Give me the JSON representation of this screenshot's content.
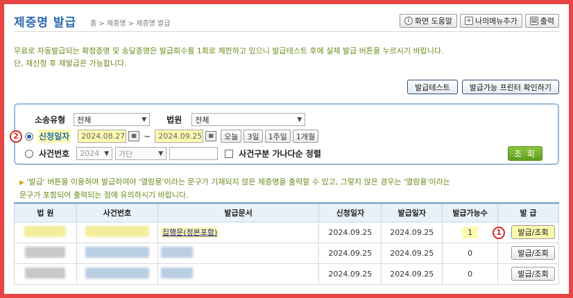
{
  "header": {
    "title": "제증명 발급",
    "breadcrumb": "홈 > 제증명 > 제증명 발급",
    "help_label": "화면 도움말",
    "mymenu_label": "나의메뉴추가",
    "print_label": "출력"
  },
  "notice": {
    "line1": "무료로 자동발급되는 확정증명 및 송달증명은 발급회수를 1회로 제한하고 있으니 발급테스트 후에 실제 발급 버튼을 누르시기 바랍니다.",
    "line2": "단, 재신청 후 재발급은 가능합니다."
  },
  "actions": {
    "test_label": "발급테스트",
    "printer_check_label": "발급가능 프린터 확인하기"
  },
  "search": {
    "type_label": "소송유형",
    "type_value": "전체",
    "court_label": "법원",
    "court_value": "전체",
    "date_label": "신청일자",
    "date_from": "2024.08.27",
    "date_to": "2024.09.25",
    "tilde": "~",
    "quick": [
      "오늘",
      "3일",
      "1주일",
      "1개월"
    ],
    "case_label": "사건번호",
    "case_year": "2024",
    "case_kind": "가단",
    "sort_label": "사건구분 가나다순 정렬",
    "search_label": "조 회",
    "badge2": "2"
  },
  "info": {
    "line1": "'발급' 버튼을 이용하여 발급하여야 '열람용'이라는 문구가 기재되지 않은 제증명을 출력할 수 있고, 그렇지 않은 경우는 '열람용'이라는",
    "line2": "문구가 포함되어 출력되는 점에 유의하시기 바랍니다."
  },
  "table": {
    "headers": [
      "법 원",
      "사건번호",
      "발급문서",
      "신청일자",
      "발급일자",
      "발급가능수",
      "발 급"
    ],
    "rows": [
      {
        "doc": "집행문(정본포함)",
        "applied": "2024.09.25",
        "issued": "2024.09.25",
        "count": "1",
        "action": "발급/조회",
        "badge": "1"
      },
      {
        "doc": "",
        "applied": "2024.09.25",
        "issued": "2024.09.25",
        "count": "0",
        "action": "발급/조회"
      },
      {
        "doc": "",
        "applied": "2024.09.25",
        "issued": "2024.09.25",
        "count": "0",
        "action": "발급/조회"
      }
    ]
  },
  "colors": {
    "accent": "#2b6cb0",
    "notice": "#6a8a1a",
    "highlight": "#fdfbb0",
    "marker": "#d62828",
    "frame": "#e84545"
  }
}
